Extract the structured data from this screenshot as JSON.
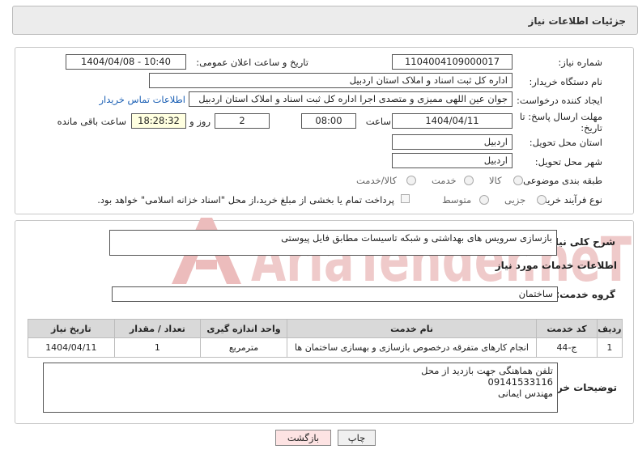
{
  "header": {
    "title": "جزئیات اطلاعات نیاز"
  },
  "form": {
    "need_number_label": "شماره نیاز:",
    "need_number": "1104004109000017",
    "announce_label": "تاریخ و ساعت اعلان عمومی:",
    "announce_value": "1404/04/08 - 10:40",
    "buyer_org_label": "نام دستگاه خریدار:",
    "buyer_org": "اداره کل ثبت اسناد و املاک استان اردبیل",
    "creator_label": "ایجاد کننده درخواست:",
    "creator": "جوان  عین اللهی ممیزی و متصدی اجرا اداره کل ثبت اسناد و املاک استان اردبیل",
    "contact_link": "اطلاعات تماس خریدار",
    "deadline_label_1": "مهلت ارسال پاسخ: تا",
    "deadline_label_2": "تاریخ:",
    "deadline_date": "1404/04/11",
    "time_label": "ساعت",
    "deadline_time": "08:00",
    "days_value": "2",
    "days_label": "روز و",
    "remaining_time": "18:28:32",
    "remaining_label": "ساعت باقی مانده",
    "province_label": "استان محل تحویل:",
    "province": "اردبیل",
    "city_label": "شهر محل تحویل:",
    "city": "اردبیل",
    "category_label": "طبقه بندی موضوعی:",
    "category_options": [
      "کالا",
      "خدمت",
      "کالا/خدمت"
    ],
    "purchase_label": "نوع فرآیند خرید :",
    "purchase_options": [
      "جزیی",
      "متوسط"
    ],
    "payment_note": "پرداخت تمام یا بخشی از مبلغ خرید،از محل \"اسناد خزانه اسلامی\" خواهد بود."
  },
  "summary": {
    "label": "شرح کلی نیاز:",
    "value": "بازسازی سرویس های بهداشتی و شبکه تاسیسات مطابق فایل پیوستی",
    "services_heading": "اطلاعات خدمات مورد نیاز",
    "service_group_label": "گروه خدمت:",
    "service_group": "ساختمان"
  },
  "table": {
    "headers": [
      "ردیف",
      "کد خدمت",
      "نام خدمت",
      "واحد اندازه گیری",
      "تعداد / مقدار",
      "تاریخ نیاز"
    ],
    "rows": [
      [
        "1",
        "ج-44",
        "انجام کارهای متفرقه درخصوص بازسازی و بهسازی ساختمان ها",
        "مترمربع",
        "1",
        "1404/04/11"
      ]
    ]
  },
  "notes": {
    "label": "توضیحات خریدار:",
    "value": "تلفن هماهنگی جهت بازدید از محل\n09141533116\nمهندس ایمانی"
  },
  "buttons": {
    "print": "چاپ",
    "back": "بازگشت"
  },
  "watermark": {
    "text": "AriaTender.neT"
  },
  "colors": {
    "link": "#1a5fb4",
    "back_button_bg": "#fde3e3",
    "watermark": "#e4a8a8"
  }
}
